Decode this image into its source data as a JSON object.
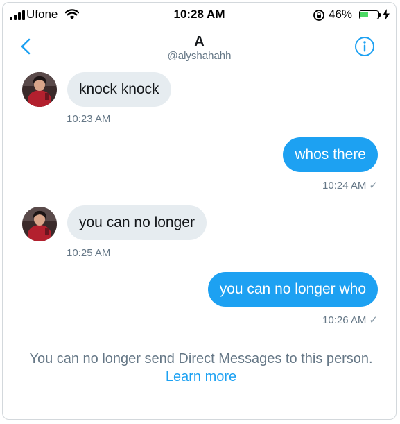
{
  "status_bar": {
    "carrier": "Ufone",
    "time": "10:28 AM",
    "battery_percent": "46%",
    "battery_level": 0.46,
    "icons": [
      "signal-icon",
      "wifi-icon",
      "orientation-lock-icon",
      "battery-icon",
      "charging-bolt-icon"
    ]
  },
  "header": {
    "name": "A",
    "handle": "@alyshahahh",
    "back_icon": "chevron-left-icon",
    "info_icon": "info-icon",
    "accent_color": "#1da1f2"
  },
  "messages": [
    {
      "direction": "incoming",
      "text": "knock knock",
      "time": "10:23 AM"
    },
    {
      "direction": "outgoing",
      "text": "whos there",
      "time": "10:24 AM",
      "status": "✓"
    },
    {
      "direction": "incoming",
      "text": "you can no longer",
      "time": "10:25 AM"
    },
    {
      "direction": "outgoing",
      "text": "you can no longer who",
      "time": "10:26 AM",
      "status": "✓"
    }
  ],
  "notice": {
    "text": "You can no longer send Direct Messages to this person.",
    "link": "Learn more"
  },
  "colors": {
    "outgoing_bubble": "#1da1f2",
    "incoming_bubble": "#e6ecf0",
    "secondary_text": "#657786"
  }
}
